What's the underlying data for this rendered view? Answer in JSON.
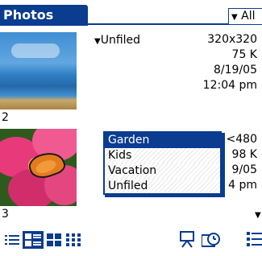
{
  "app": {
    "title": "Photos"
  },
  "category_trigger": {
    "label": "All",
    "icon": "triangle-down-icon"
  },
  "photos": [
    {
      "number": "2",
      "category": "Unfiled",
      "resolution": "320x320",
      "size": "75 K",
      "date": "8/19/05",
      "time": "12:04 pm"
    },
    {
      "number": "3",
      "resolution": "<480",
      "size": "98 K",
      "date": "9/05",
      "time": "4 pm"
    }
  ],
  "category_popup": {
    "items": [
      "Garden",
      "Kids",
      "Vacation",
      "Unfiled"
    ],
    "selected_index": 0
  },
  "toolbar": {
    "view_icons": [
      "list-view-icon",
      "detail-view-icon",
      "grid-view-icon",
      "thumbnail-view-icon"
    ],
    "active_view_index": 1,
    "right_icons": [
      "slideshow-icon",
      "clock-icon",
      "menu-icon"
    ]
  },
  "colors": {
    "accent": "#0a3c90"
  }
}
